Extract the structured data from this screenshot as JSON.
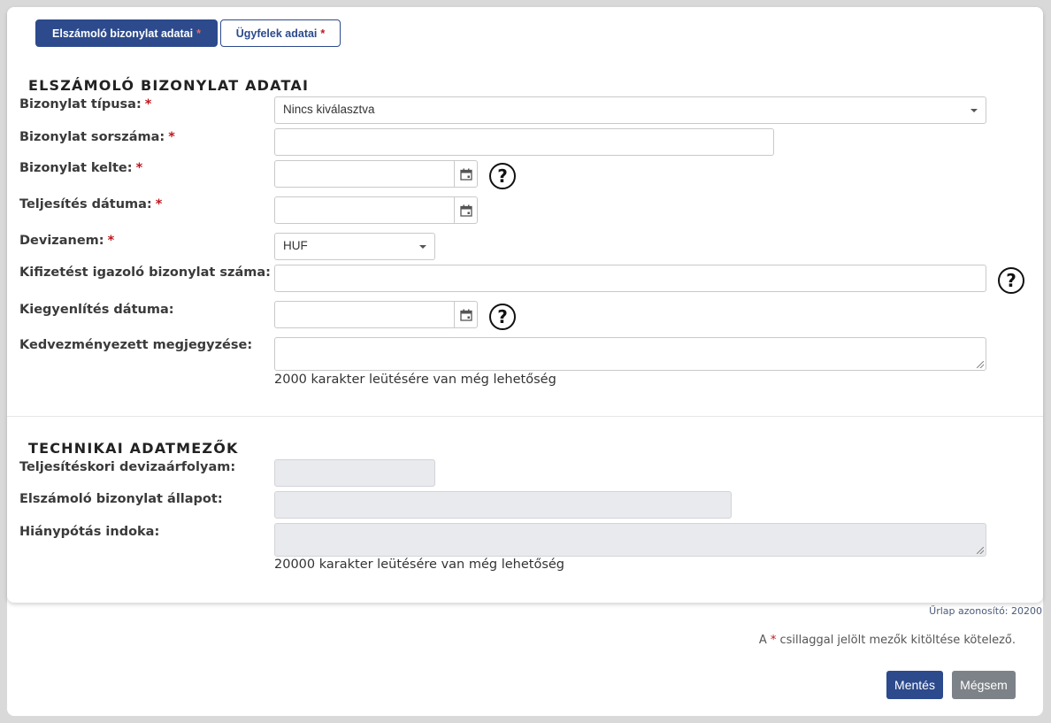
{
  "tabs": {
    "active": {
      "label": "Elszámoló bizonylat adatai",
      "required_mark": "*"
    },
    "inactive": {
      "label": "Ügyfelek adatai",
      "required_mark": "*"
    }
  },
  "section1": {
    "title": "ELSZÁMOLÓ BIZONYLAT ADATAI",
    "fields": {
      "type": {
        "label": "Bizonylat típusa:",
        "required_mark": "*",
        "value": "Nincs kiválasztva"
      },
      "serial": {
        "label": "Bizonylat sorszáma:",
        "required_mark": "*",
        "value": ""
      },
      "issue_date": {
        "label": "Bizonylat kelte:",
        "required_mark": "*",
        "value": ""
      },
      "completion_date": {
        "label": "Teljesítés dátuma:",
        "required_mark": "*",
        "value": ""
      },
      "currency": {
        "label": "Devizanem:",
        "required_mark": "*",
        "value": "HUF"
      },
      "payment_doc": {
        "label": "Kifizetést igazoló bizonylat száma:",
        "value": ""
      },
      "settlement_date": {
        "label": "Kiegyenlítés dátuma:",
        "value": ""
      },
      "beneficiary_note": {
        "label": "Kedvezményezett megjegyzése:",
        "value": "",
        "counter": "2000 karakter leütésére van még lehetőség"
      }
    },
    "help_symbol": "?"
  },
  "section2": {
    "title": "TECHNIKAI ADATMEZŐK",
    "fields": {
      "exchange_rate": {
        "label": "Teljesítéskori devizaárfolyam:",
        "value": ""
      },
      "status": {
        "label": "Elszámoló bizonylat állapot:",
        "value": ""
      },
      "deficiency_reason": {
        "label": "Hiánypótás indoka:",
        "value": "",
        "counter": "20000 karakter leütésére van még lehetőség"
      }
    }
  },
  "footer": {
    "form_id": "Űrlap azonosító: 20200",
    "mandatory_prefix": "A",
    "mandatory_mark": "*",
    "mandatory_suffix": "csillaggal jelölt mezők kitöltése kötelező.",
    "save_label": "Mentés",
    "cancel_label": "Mégsem"
  },
  "colors": {
    "primary": "#2c4a8c",
    "required": "#c0161d",
    "secondary_button": "#7d8288"
  },
  "icons": [
    "calendar-icon",
    "help-icon",
    "chevron-down-icon"
  ]
}
